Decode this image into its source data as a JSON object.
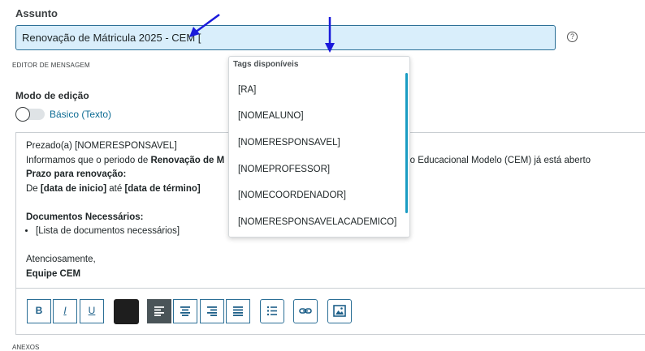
{
  "assunto": {
    "label": "Assunto",
    "value": "Renovação de Mátricula 2025 - CEM [",
    "help": "?"
  },
  "section_editor_label": "EDITOR DE MENSAGEM",
  "modo": {
    "label": "Modo de edição",
    "toggle_label": "Básico (Texto)"
  },
  "message": {
    "l1": "Prezado(a) [NOMERESPONSAVEL]",
    "l2a": "Informamos que o periodo de ",
    "l2b": "Renovação de M",
    "l2c": "Colégio Educacional Modelo (CEM) já está aberto",
    "l3": "Prazo para renovação:",
    "l4a": "De ",
    "l4b": "[data de inicio]",
    "l4c": " até ",
    "l4d": "[data de término]",
    "l5": "Documentos Necessários:",
    "l6": "[Lista de documentos necessários]",
    "l7": "Atenciosamente,",
    "l8": "Equipe CEM"
  },
  "toolbar": {
    "bold": "B",
    "italic": "I",
    "underline": "U"
  },
  "anexos_label": "ANEXOS",
  "tags": {
    "title": "Tags disponíveis",
    "items": [
      "[RA]",
      "[NOMEALUNO]",
      "[NOMERESPONSAVEL]",
      "[NOMEPROFESSOR]",
      "[NOMECOORDENADOR]",
      "[NOMERESPONSAVELACADEMICO]"
    ]
  },
  "colors": {
    "accent": "#2b6f96",
    "input_bg": "#d9eefb",
    "active_button": "#4a5458",
    "scrollbar": "#1a9cc3",
    "arrow": "#1a1adb"
  }
}
